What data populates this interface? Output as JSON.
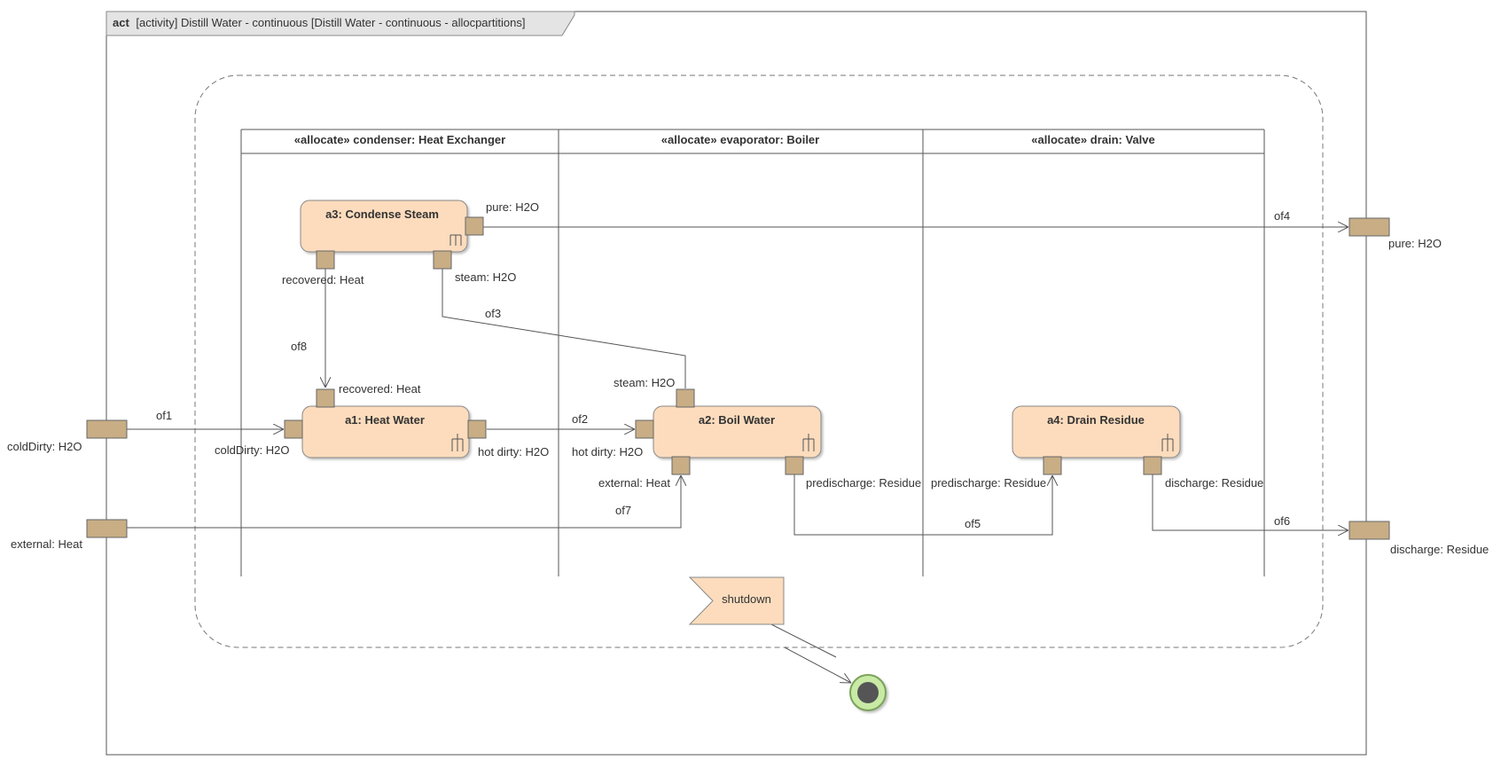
{
  "frame": {
    "keyword": "act",
    "title": "[activity] Distill Water - continuous [Distill Water - continuous - allocpartitions]"
  },
  "partitions": [
    {
      "label": "«allocate» condenser: Heat Exchanger"
    },
    {
      "label": "«allocate» evaporator: Boiler"
    },
    {
      "label": "«allocate» drain: Valve"
    }
  ],
  "actions": {
    "a1": "a1: Heat Water",
    "a2": "a2: Boil Water",
    "a3": "a3: Condense Steam",
    "a4": "a4: Drain Residue"
  },
  "pins": {
    "a3_pure": "pure: H2O",
    "a3_recovered": "recovered: Heat",
    "a3_steam": "steam: H2O",
    "a1_recovered": "recovered: Heat",
    "a1_coldDirty": "coldDirty: H2O",
    "a1_hotDirty": "hot dirty: H2O",
    "a2_steam": "steam: H2O",
    "a2_hotDirty": "hot dirty: H2O",
    "a2_external": "external: Heat",
    "a2_predischarge": "predischarge: Residue",
    "a4_predischarge": "predischarge: Residue",
    "a4_discharge": "discharge: Residue"
  },
  "parameters": {
    "coldDirty": "coldDirty: H2O",
    "external": "external: Heat",
    "pure": "pure: H2O",
    "discharge": "discharge: Residue"
  },
  "flows": {
    "of1": "of1",
    "of2": "of2",
    "of3": "of3",
    "of4": "of4",
    "of5": "of5",
    "of6": "of6",
    "of7": "of7",
    "of8": "of8"
  },
  "signal": "shutdown",
  "colors": {
    "action_fill": "#fcdcbd",
    "pin_fill": "#c8ad85",
    "line": "#555555",
    "final_ring": "#c8eaa4",
    "final_ring_stroke": "#7aa35a",
    "final_dot": "#555555"
  }
}
